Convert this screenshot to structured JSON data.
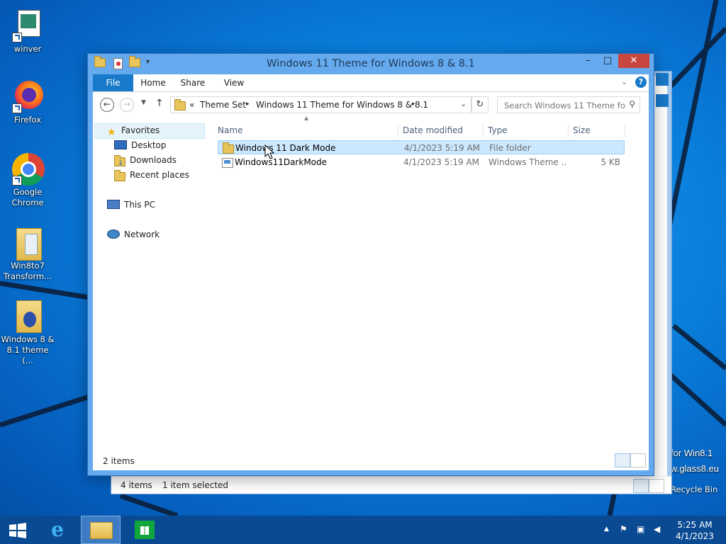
{
  "desktop": {
    "icons": [
      {
        "label": "winver"
      },
      {
        "label": "Firefox"
      },
      {
        "label": "Google Chrome"
      },
      {
        "label": "Win8to7 Transform..."
      },
      {
        "label": "Windows 8 & 8.1 theme (..."
      }
    ],
    "right_side_text_1": "for Win8.1",
    "right_side_text_2": "w.glass8.eu",
    "recycle_bin": "Recycle Bin"
  },
  "background_window": {
    "status_items": "4 items",
    "status_selected": "1 item selected"
  },
  "window": {
    "title": "Windows 11 Theme for Windows 8 & 8.1",
    "controls": {
      "minimize": "–",
      "maximize": "□",
      "close": "✕"
    },
    "ribbon_tabs": [
      "File",
      "Home",
      "Share",
      "View"
    ],
    "address": {
      "prefix": "«",
      "crumbs": [
        "Theme Set",
        "Windows 11 Theme for Windows 8 & 8.1"
      ]
    },
    "search": {
      "placeholder": "Search Windows 11 Theme fo..."
    },
    "nav": {
      "favorites": "Favorites",
      "desktop": "Desktop",
      "downloads": "Downloads",
      "recent": "Recent places",
      "this_pc": "This PC",
      "network": "Network"
    },
    "columns": {
      "name": "Name",
      "date": "Date modified",
      "type": "Type",
      "size": "Size"
    },
    "files": [
      {
        "name": "Windows 11 Dark Mode",
        "date": "4/1/2023 5:19 AM",
        "type": "File folder",
        "size": ""
      },
      {
        "name": "Windows11DarkMode",
        "date": "4/1/2023 5:19 AM",
        "type": "Windows Theme ...",
        "size": "5 KB"
      }
    ],
    "status": {
      "count": "2 items"
    }
  },
  "taskbar": {
    "time": "5:25 AM",
    "date": "4/1/2023"
  },
  "colors": {
    "accent": "#1979ca",
    "selection": "#cce8ff",
    "taskbar": "#0a4a93"
  }
}
